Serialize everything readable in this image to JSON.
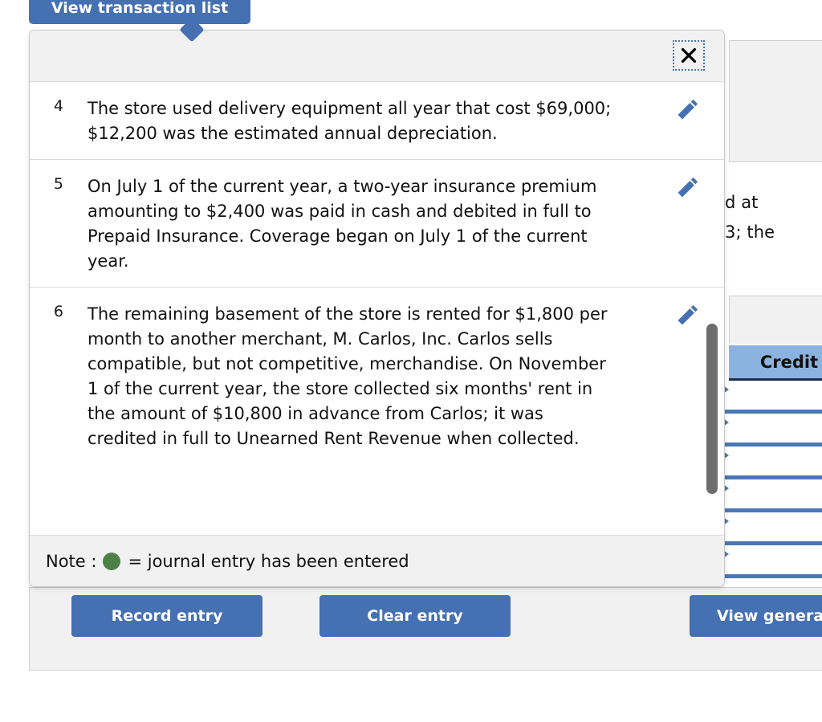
{
  "tab_button": {
    "label": "View transaction list"
  },
  "modal": {
    "close_icon_label": "Close",
    "transactions": [
      {
        "number": "4",
        "text": "The store used delivery equipment all year that cost $69,000; $12,200 was the estimated annual depreciation."
      },
      {
        "number": "5",
        "text": "On July 1 of the current year, a two-year insurance premium amounting to $2,400 was paid in cash and debited in full to Prepaid Insurance. Coverage began on July 1 of the current year."
      },
      {
        "number": "6",
        "text": "The remaining basement of the store is rented for $1,800 per month to another merchant, M. Carlos, Inc. Carlos sells compatible, but not competitive, merchandise. On November 1 of the current year, the store collected six months' rent in the amount of $10,800 in advance from Carlos; it was credited in full to Unearned Rent Revenue when collected."
      }
    ],
    "note": {
      "prefix": "Note :",
      "suffix": "= journal entry has been entered",
      "dot_color": "#4d8046"
    }
  },
  "background": {
    "text_fragments": [
      "d at",
      "3; the"
    ],
    "table": {
      "credit_header": "Credit",
      "row_count": 6
    }
  },
  "actions": {
    "record_entry": "Record entry",
    "clear_entry": "Clear entry",
    "view_general": "View general"
  },
  "colors": {
    "accent_blue": "#4571b3",
    "header_blue": "#8bb3e0",
    "row_rule_blue": "#4b77b8",
    "panel_gray": "#f1f1f1",
    "green": "#4d8046"
  }
}
